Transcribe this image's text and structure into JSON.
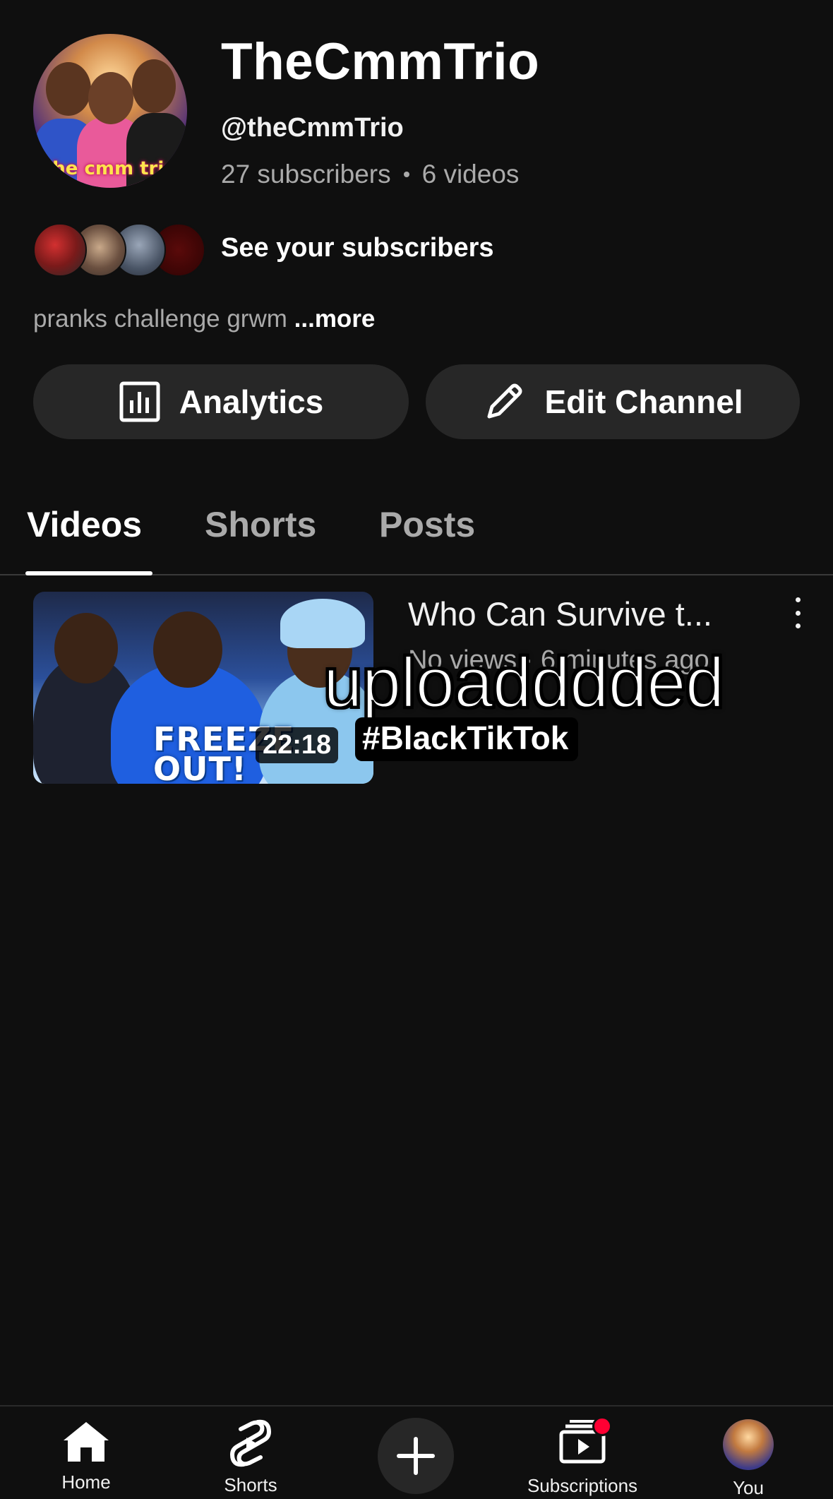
{
  "channel": {
    "name": "TheCmmTrio",
    "handle": "@theCmmTrio",
    "subscribers": "27 subscribers",
    "videos": "6 videos",
    "avatar_text": "the cmm trio",
    "see_subscribers": "See your subscribers",
    "description": "pranks challenge grwm",
    "more_label": "...more"
  },
  "actions": {
    "analytics_label": "Analytics",
    "edit_label": "Edit Channel"
  },
  "tabs": [
    {
      "label": "Videos",
      "active": true
    },
    {
      "label": "Shorts",
      "active": false
    },
    {
      "label": "Posts",
      "active": false
    }
  ],
  "video": {
    "title": "Who Can Survive t...",
    "meta": "No views · 6 minutes ago",
    "meta2": "0",
    "duration": "22:18",
    "thumbnail_text": "FREEZE OUT!"
  },
  "overlay": {
    "caption": "uploadddded",
    "tag": "#BlackTikTok"
  },
  "nav": {
    "home": "Home",
    "shorts": "Shorts",
    "subscriptions": "Subscriptions",
    "you": "You"
  },
  "colors": {
    "background": "#0f0f0f",
    "button_bg": "#272727",
    "secondary_text": "#aaaaaa",
    "notification": "#ff0033"
  }
}
